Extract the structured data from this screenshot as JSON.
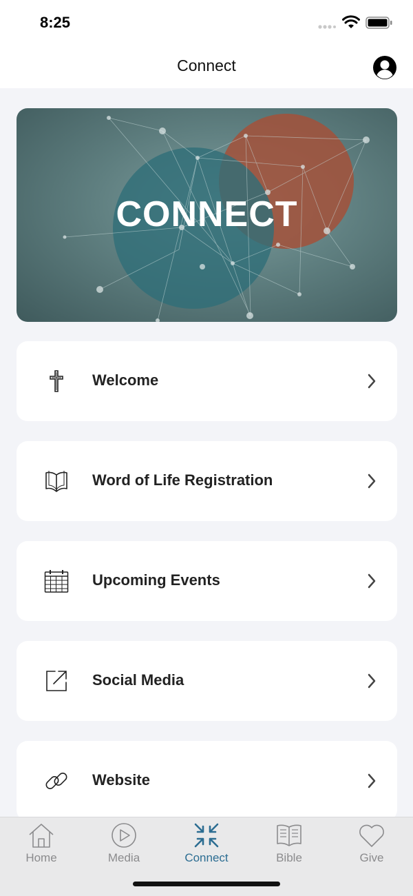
{
  "status": {
    "time": "8:25"
  },
  "nav": {
    "title": "Connect"
  },
  "banner": {
    "text": "CONNECT"
  },
  "items": [
    {
      "label": "Welcome",
      "icon": "cross-icon"
    },
    {
      "label": "Word of Life Registration",
      "icon": "book-icon"
    },
    {
      "label": "Upcoming Events",
      "icon": "calendar-icon"
    },
    {
      "label": "Social Media",
      "icon": "external-link-icon"
    },
    {
      "label": "Website",
      "icon": "link-icon"
    }
  ],
  "tabs": [
    {
      "label": "Home",
      "icon": "home-icon"
    },
    {
      "label": "Media",
      "icon": "play-icon"
    },
    {
      "label": "Connect",
      "icon": "connect-icon",
      "active": true
    },
    {
      "label": "Bible",
      "icon": "bible-icon"
    },
    {
      "label": "Give",
      "icon": "heart-icon"
    }
  ],
  "colors": {
    "accent": "#2c6d92",
    "background": "#f3f4f8",
    "card": "#ffffff",
    "tab_inactive": "#8b8b8d"
  }
}
